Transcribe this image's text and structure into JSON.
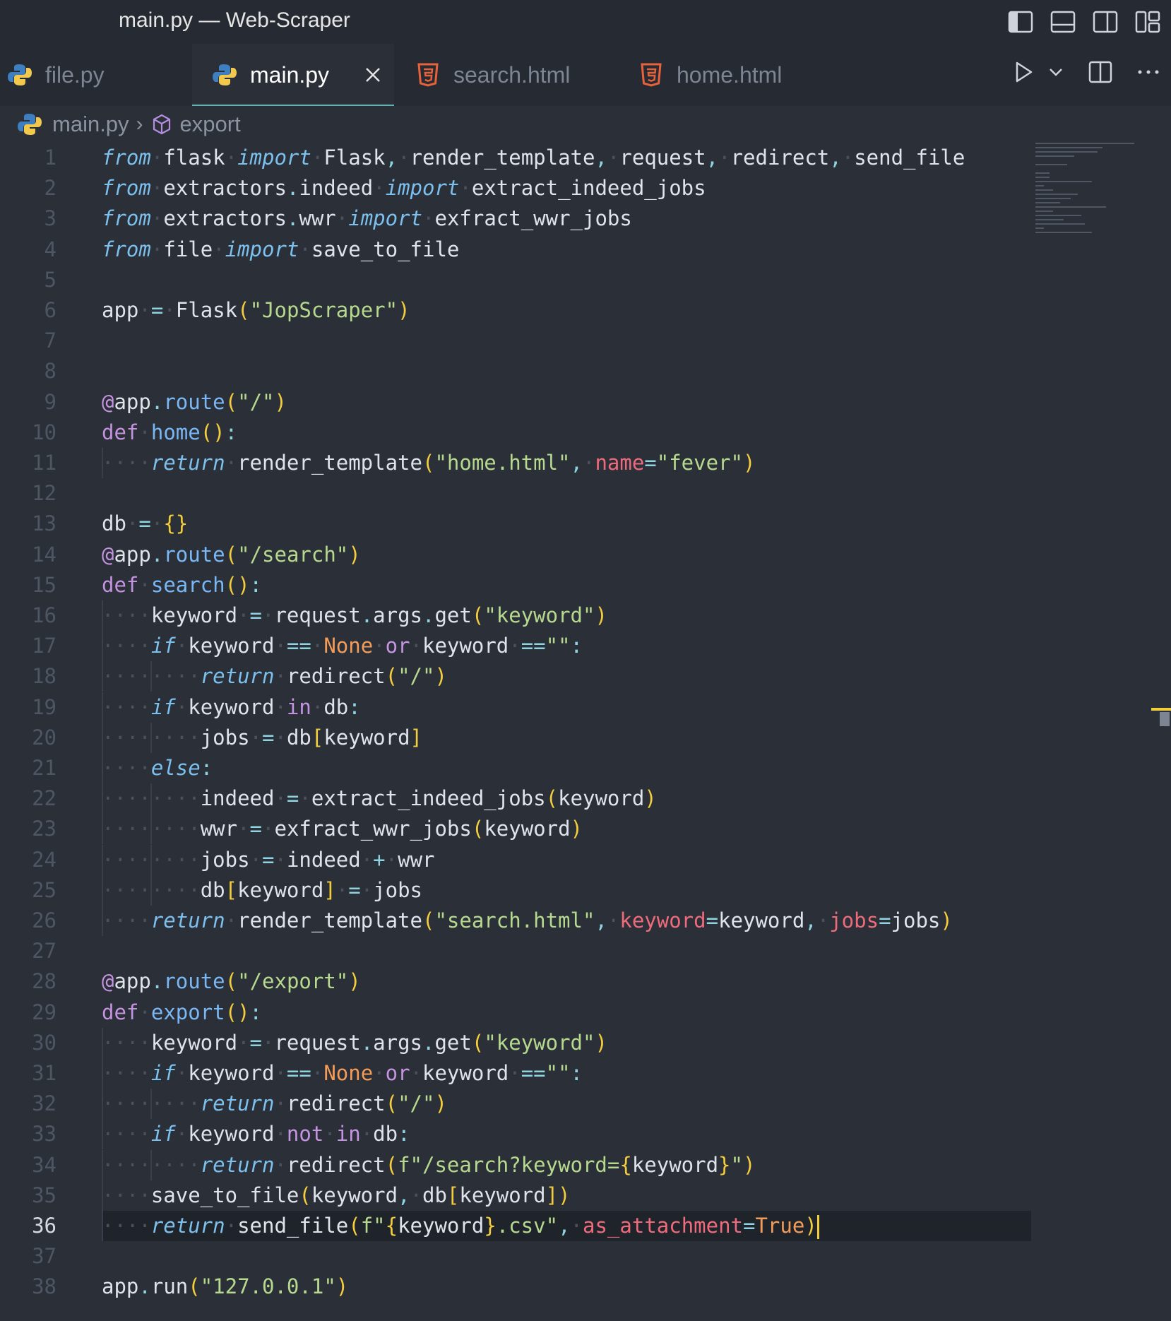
{
  "window": {
    "title": "main.py — Web-Scraper"
  },
  "tabs": [
    {
      "label": "file.py",
      "icon": "python-icon"
    },
    {
      "label": "main.py",
      "icon": "python-icon",
      "active": true
    },
    {
      "label": "search.html",
      "icon": "html5-icon"
    },
    {
      "label": "home.html",
      "icon": "html5-icon"
    }
  ],
  "breadcrumb": {
    "file": "main.py",
    "symbol": "export"
  },
  "editor": {
    "current_line": 36,
    "line_numbers": [
      "1",
      "2",
      "3",
      "4",
      "5",
      "6",
      "7",
      "8",
      "9",
      "10",
      "11",
      "12",
      "13",
      "14",
      "15",
      "16",
      "17",
      "18",
      "19",
      "20",
      "21",
      "22",
      "23",
      "24",
      "25",
      "26",
      "27",
      "28",
      "29",
      "30",
      "31",
      "32",
      "33",
      "34",
      "35",
      "36",
      "37",
      "38"
    ]
  },
  "colors": {
    "background": "#2a2f38",
    "keyword": "#7cc0ee",
    "string": "#b6d98e",
    "bracket": "#f4cd3c",
    "parameter": "#ef6b7b",
    "constant": "#f39c57",
    "decorator_def": "#c594e0"
  }
}
